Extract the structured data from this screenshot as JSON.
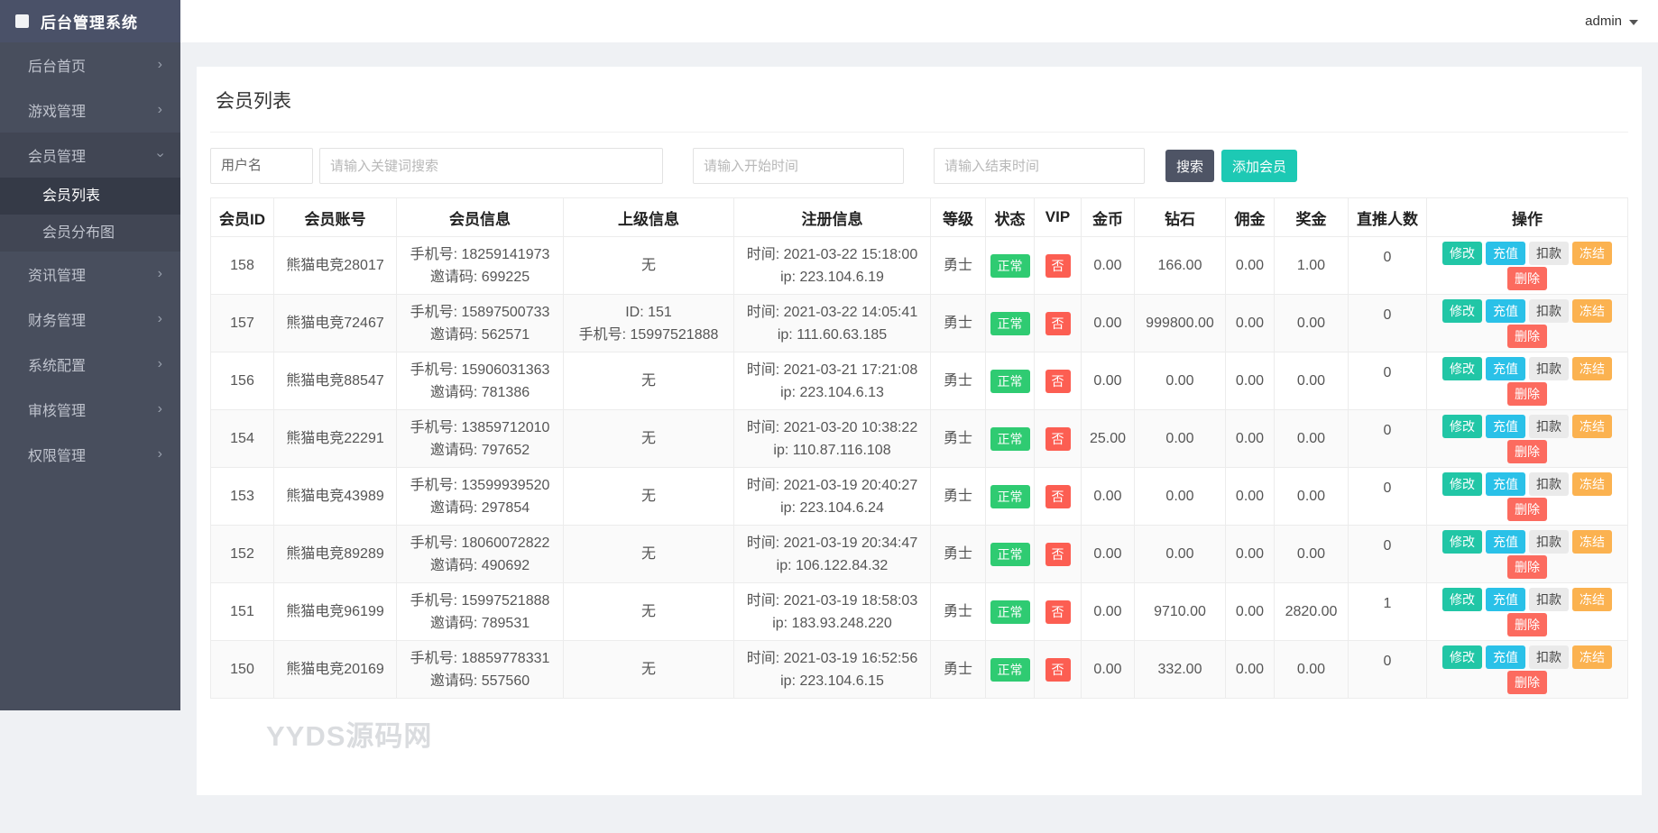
{
  "app": {
    "title": "后台管理系统",
    "user": "admin"
  },
  "sidebar": {
    "items": [
      {
        "key": "home",
        "label": "后台首页"
      },
      {
        "key": "game",
        "label": "游戏管理"
      },
      {
        "key": "member",
        "label": "会员管理",
        "expanded": true,
        "children": [
          {
            "key": "member-list",
            "label": "会员列表",
            "active": true
          },
          {
            "key": "member-map",
            "label": "会员分布图"
          }
        ]
      },
      {
        "key": "news",
        "label": "资讯管理"
      },
      {
        "key": "finance",
        "label": "财务管理"
      },
      {
        "key": "system",
        "label": "系统配置"
      },
      {
        "key": "audit",
        "label": "审核管理"
      },
      {
        "key": "permission",
        "label": "权限管理"
      }
    ]
  },
  "page": {
    "title": "会员列表",
    "watermark": "YYDS源码网"
  },
  "search": {
    "field_selector": "用户名",
    "keyword_placeholder": "请输入关键词搜索",
    "start_placeholder": "请输入开始时间",
    "end_placeholder": "请输入结束时间",
    "search_label": "搜索",
    "add_label": "添加会员"
  },
  "table": {
    "headers": [
      "会员ID",
      "会员账号",
      "会员信息",
      "上级信息",
      "注册信息",
      "等级",
      "状态",
      "VIP",
      "金币",
      "钻石",
      "佣金",
      "奖金",
      "直推人数",
      "操作"
    ],
    "action_buttons": [
      {
        "key": "edit",
        "label": "修改"
      },
      {
        "key": "recharge",
        "label": "充值"
      },
      {
        "key": "deduct",
        "label": "扣款"
      },
      {
        "key": "freeze",
        "label": "冻结"
      },
      {
        "key": "delete",
        "label": "删除"
      }
    ],
    "rows": [
      {
        "id": "158",
        "account": "熊猫电竞28017",
        "member_info": [
          "手机号: 18259141973",
          "邀请码: 699225"
        ],
        "parent_info": [
          "无"
        ],
        "register_info": [
          "时间: 2021-03-22 15:18:00",
          "ip: 223.104.6.19"
        ],
        "level": "勇士",
        "status": "正常",
        "vip": "否",
        "gold": "0.00",
        "diamond": "166.00",
        "commission": "0.00",
        "bonus": "1.00",
        "referrals": "0"
      },
      {
        "id": "157",
        "account": "熊猫电竞72467",
        "member_info": [
          "手机号: 15897500733",
          "邀请码: 562571"
        ],
        "parent_info": [
          "ID: 151",
          "手机号: 15997521888"
        ],
        "register_info": [
          "时间: 2021-03-22 14:05:41",
          "ip: 111.60.63.185"
        ],
        "level": "勇士",
        "status": "正常",
        "vip": "否",
        "gold": "0.00",
        "diamond": "999800.00",
        "commission": "0.00",
        "bonus": "0.00",
        "referrals": "0"
      },
      {
        "id": "156",
        "account": "熊猫电竞88547",
        "member_info": [
          "手机号: 15906031363",
          "邀请码: 781386"
        ],
        "parent_info": [
          "无"
        ],
        "register_info": [
          "时间: 2021-03-21 17:21:08",
          "ip: 223.104.6.13"
        ],
        "level": "勇士",
        "status": "正常",
        "vip": "否",
        "gold": "0.00",
        "diamond": "0.00",
        "commission": "0.00",
        "bonus": "0.00",
        "referrals": "0"
      },
      {
        "id": "154",
        "account": "熊猫电竞22291",
        "member_info": [
          "手机号: 13859712010",
          "邀请码: 797652"
        ],
        "parent_info": [
          "无"
        ],
        "register_info": [
          "时间: 2021-03-20 10:38:22",
          "ip: 110.87.116.108"
        ],
        "level": "勇士",
        "status": "正常",
        "vip": "否",
        "gold": "25.00",
        "diamond": "0.00",
        "commission": "0.00",
        "bonus": "0.00",
        "referrals": "0"
      },
      {
        "id": "153",
        "account": "熊猫电竞43989",
        "member_info": [
          "手机号: 13599939520",
          "邀请码: 297854"
        ],
        "parent_info": [
          "无"
        ],
        "register_info": [
          "时间: 2021-03-19 20:40:27",
          "ip: 223.104.6.24"
        ],
        "level": "勇士",
        "status": "正常",
        "vip": "否",
        "gold": "0.00",
        "diamond": "0.00",
        "commission": "0.00",
        "bonus": "0.00",
        "referrals": "0"
      },
      {
        "id": "152",
        "account": "熊猫电竞89289",
        "member_info": [
          "手机号: 18060072822",
          "邀请码: 490692"
        ],
        "parent_info": [
          "无"
        ],
        "register_info": [
          "时间: 2021-03-19 20:34:47",
          "ip: 106.122.84.32"
        ],
        "level": "勇士",
        "status": "正常",
        "vip": "否",
        "gold": "0.00",
        "diamond": "0.00",
        "commission": "0.00",
        "bonus": "0.00",
        "referrals": "0"
      },
      {
        "id": "151",
        "account": "熊猫电竞96199",
        "member_info": [
          "手机号: 15997521888",
          "邀请码: 789531"
        ],
        "parent_info": [
          "无"
        ],
        "register_info": [
          "时间: 2021-03-19 18:58:03",
          "ip: 183.93.248.220"
        ],
        "level": "勇士",
        "status": "正常",
        "vip": "否",
        "gold": "0.00",
        "diamond": "9710.00",
        "commission": "0.00",
        "bonus": "2820.00",
        "referrals": "1"
      },
      {
        "id": "150",
        "account": "熊猫电竞20169",
        "member_info": [
          "手机号: 18859778331",
          "邀请码: 557560"
        ],
        "parent_info": [
          "无"
        ],
        "register_info": [
          "时间: 2021-03-19 16:52:56",
          "ip: 223.104.6.15"
        ],
        "level": "勇士",
        "status": "正常",
        "vip": "否",
        "gold": "0.00",
        "diamond": "332.00",
        "commission": "0.00",
        "bonus": "0.00",
        "referrals": "0"
      }
    ]
  },
  "colors": {
    "sidebar_bg": "#484e5d",
    "sidebar_logo_bg": "#4a5168",
    "sidebar_active_bg": "#353a47",
    "page_bg": "#eff1f4",
    "accent_teal": "#1dc9b4",
    "search_button": "#4e5465",
    "status_normal_green": "#2fcb72",
    "vip_no_red": "#fc5e52",
    "action_edit": "#21c6a6",
    "action_recharge": "#2ac1e8",
    "action_deduct_bg": "#eaeaea",
    "action_freeze": "#fbb250",
    "action_delete": "#fc6b5f"
  }
}
